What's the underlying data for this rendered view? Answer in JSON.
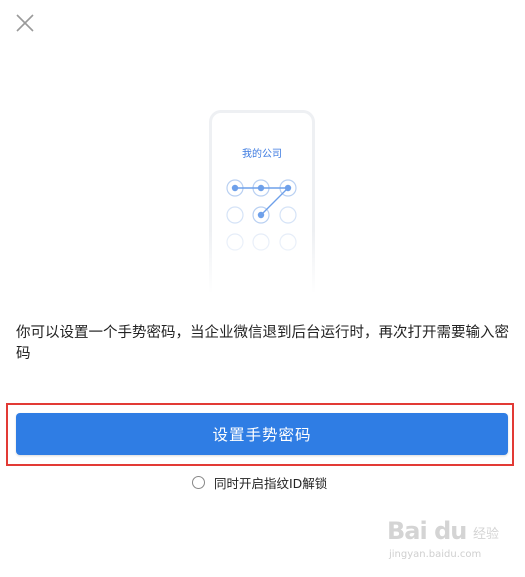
{
  "header": {
    "close_icon": "close-icon"
  },
  "illustration": {
    "title": "我的公司",
    "pattern_dot_color": "#6ea0ea",
    "pattern_grid": [
      [
        true,
        true,
        true
      ],
      [
        false,
        true,
        false
      ],
      [
        false,
        false,
        false
      ]
    ]
  },
  "main": {
    "description": "你可以设置一个手势密码，当企业微信退到后台运行时，再次打开需要输入密码",
    "primary_button_label": "设置手势密码",
    "fingerprint_option": {
      "label": "同时开启指纹ID解锁",
      "checked": false
    }
  },
  "watermark": {
    "logo": "Bai du",
    "sub": "经验",
    "url": "jingyan.baidu.com"
  },
  "colors": {
    "accent": "#2f7de4",
    "highlight": "#e23a35"
  }
}
